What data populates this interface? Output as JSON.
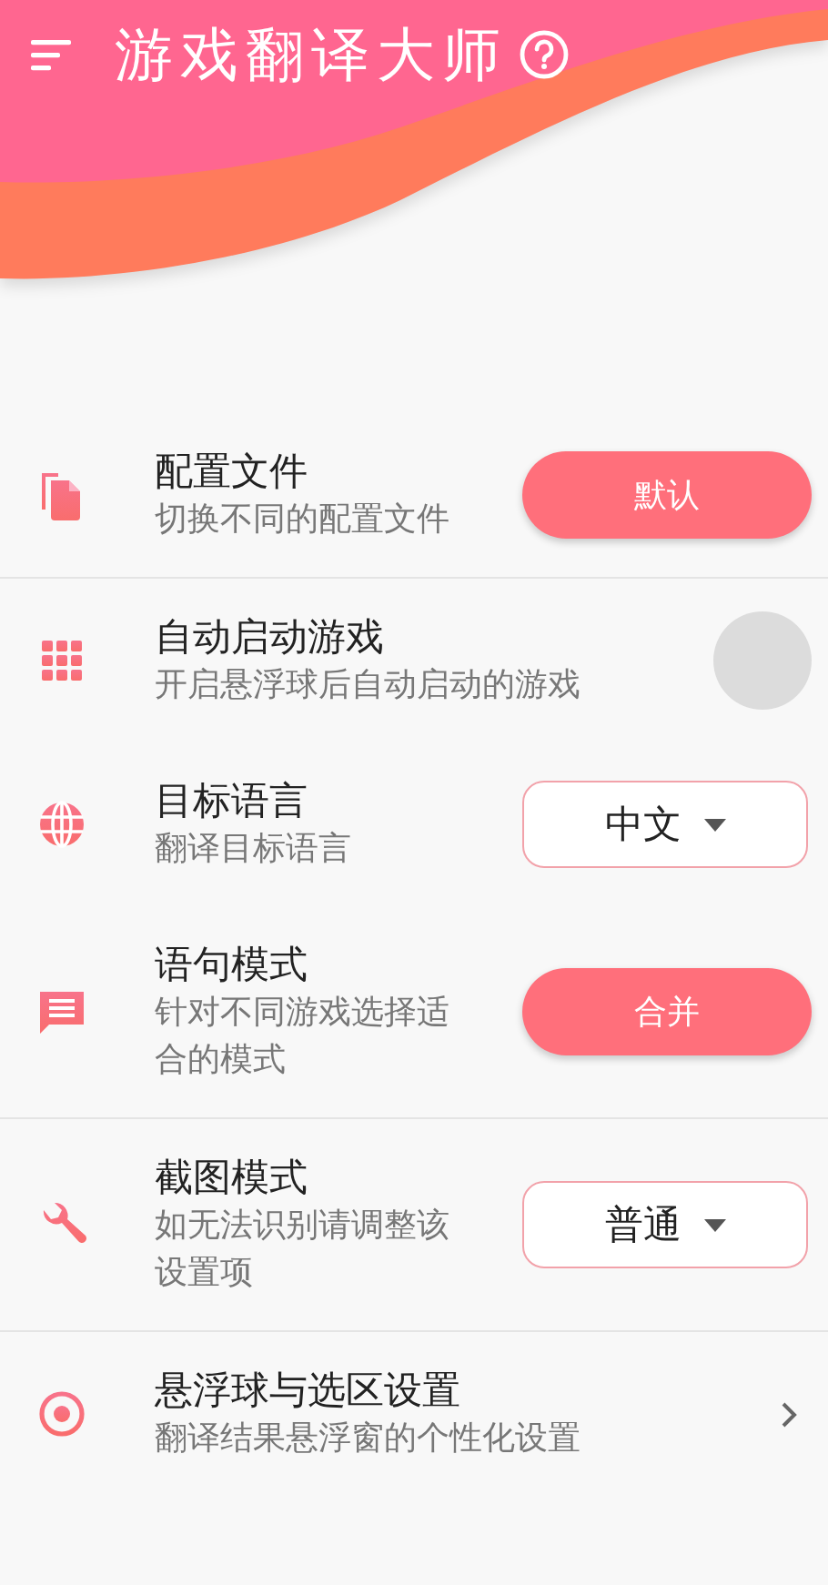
{
  "app_bar": {
    "title": "游戏翻译大师"
  },
  "settings": [
    {
      "kind": "button",
      "title": "配置文件",
      "subtitle": "切换不同的配置文件",
      "value": "默认",
      "divider": true
    },
    {
      "kind": "switch",
      "title": "自动启动游戏",
      "subtitle": "开启悬浮球后自动启动的游戏",
      "on": false,
      "divider": false
    },
    {
      "kind": "dropdown",
      "title": "目标语言",
      "subtitle": "翻译目标语言",
      "value": "中文",
      "divider": false
    },
    {
      "kind": "button",
      "title": "语句模式",
      "subtitle": "针对不同游戏选择适合的模式",
      "value": "合并",
      "divider": true
    },
    {
      "kind": "dropdown",
      "title": "截图模式",
      "subtitle": "如无法识别请调整该设置项",
      "value": "普通",
      "divider": true
    },
    {
      "kind": "link",
      "title": "悬浮球与选区设置",
      "subtitle": "翻译结果悬浮窗的个性化设置",
      "divider": false
    }
  ]
}
